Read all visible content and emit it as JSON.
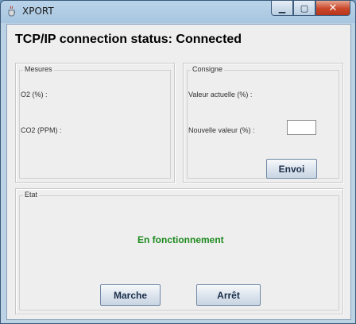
{
  "window": {
    "title": "XPORT",
    "close_glyph": "✕",
    "min_glyph": "▁",
    "max_glyph": "▢"
  },
  "header": {
    "connection_status": "TCP/IP connection status: Connected"
  },
  "mesures": {
    "legend": "Mesures",
    "o2_label": "O2 (%) :",
    "co2_label": "CO2 (PPM) :"
  },
  "consigne": {
    "legend": "Consigne",
    "current_label": "Valeur actuelle (%) :",
    "new_label": "Nouvelle valeur (%) :",
    "new_value": "",
    "send_button": "Envoi"
  },
  "etat": {
    "legend": "Etat",
    "status_text": "En fonctionnement",
    "status_color": "#1f8a1f",
    "start_button": "Marche",
    "stop_button": "Arrêt"
  },
  "icons": {
    "app": "java-cup-icon",
    "minimize": "minimize-icon",
    "maximize": "maximize-icon",
    "close": "close-icon"
  }
}
